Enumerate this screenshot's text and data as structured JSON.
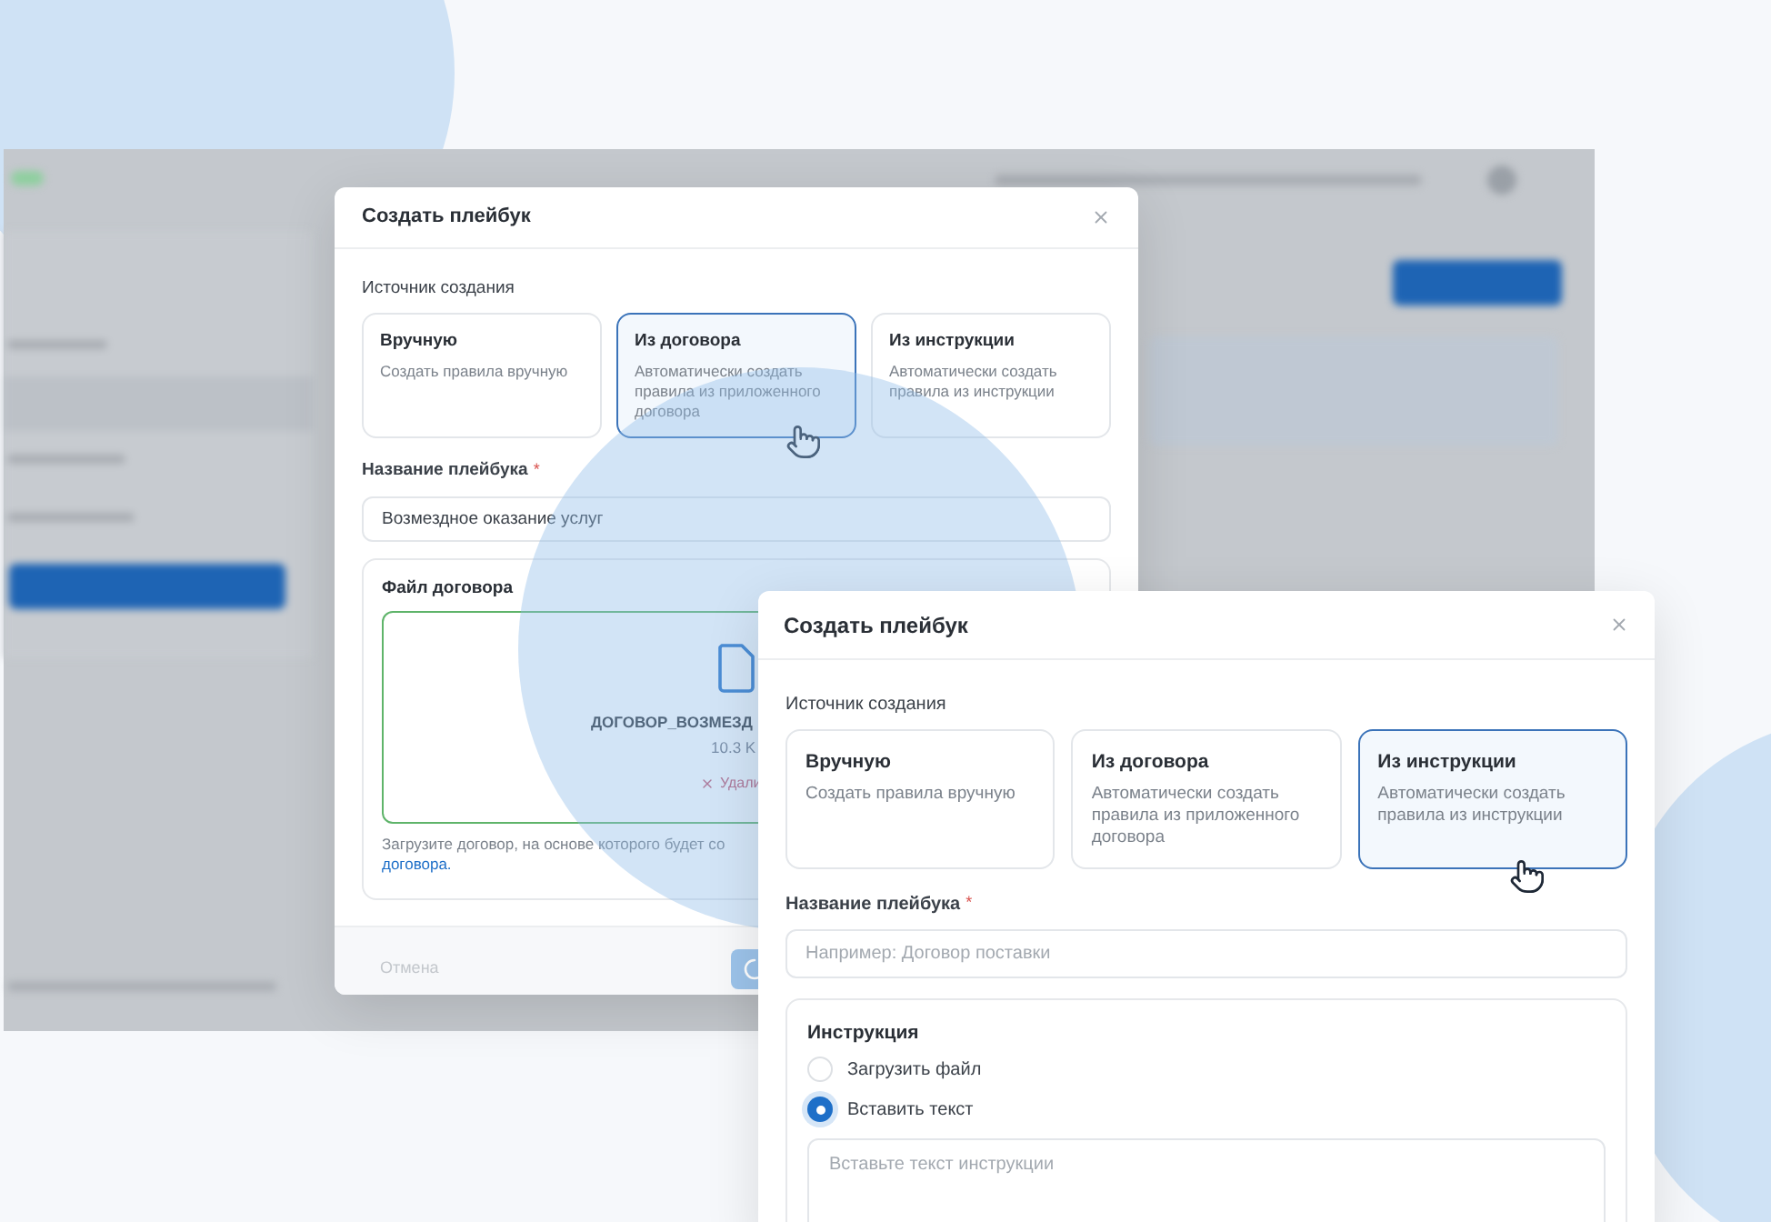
{
  "modals": [
    {
      "title": "Создать плейбук",
      "source_label": "Источник создания",
      "sources": [
        {
          "title": "Вручную",
          "description": "Создать правила вручную",
          "selected": false
        },
        {
          "title": "Из договора",
          "description": "Автоматически создать правила из приложенного договора",
          "selected": true
        },
        {
          "title": "Из инструкции",
          "description": "Автоматически создать правила из инструкции",
          "selected": false
        }
      ],
      "name_label": "Название плейбука",
      "required_mark": "*",
      "name_field": {
        "value": "Возмездное оказание услуг"
      },
      "section": {
        "kind": "file",
        "label": "Файл договора",
        "file_name": "ДОГОВОР_ВОЗМЕЗД",
        "file_size": "10.3 K",
        "remove": "Удали",
        "hint": "Загрузите договор, на основе которого будет со",
        "hint_link": "договора."
      },
      "footer": {
        "cancel": "Отмена",
        "submit_loading": true
      }
    },
    {
      "title": "Создать плейбук",
      "source_label": "Источник создания",
      "sources": [
        {
          "title": "Вручную",
          "description": "Создать правила вручную",
          "selected": false
        },
        {
          "title": "Из договора",
          "description": "Автоматически создать правила из приложенного договора",
          "selected": false
        },
        {
          "title": "Из инструкции",
          "description": "Автоматически создать правила из инструкции",
          "selected": true
        }
      ],
      "name_label": "Название плейбука",
      "required_mark": "*",
      "name_field": {
        "placeholder": "Например: Договор поставки"
      },
      "section": {
        "kind": "instruction",
        "label": "Инструкция",
        "options": [
          {
            "label": "Загрузить файл",
            "selected": false
          },
          {
            "label": "Вставить текст",
            "selected": true
          }
        ],
        "textarea": {
          "placeholder": "Вставьте текст инструкции"
        }
      }
    }
  ]
}
